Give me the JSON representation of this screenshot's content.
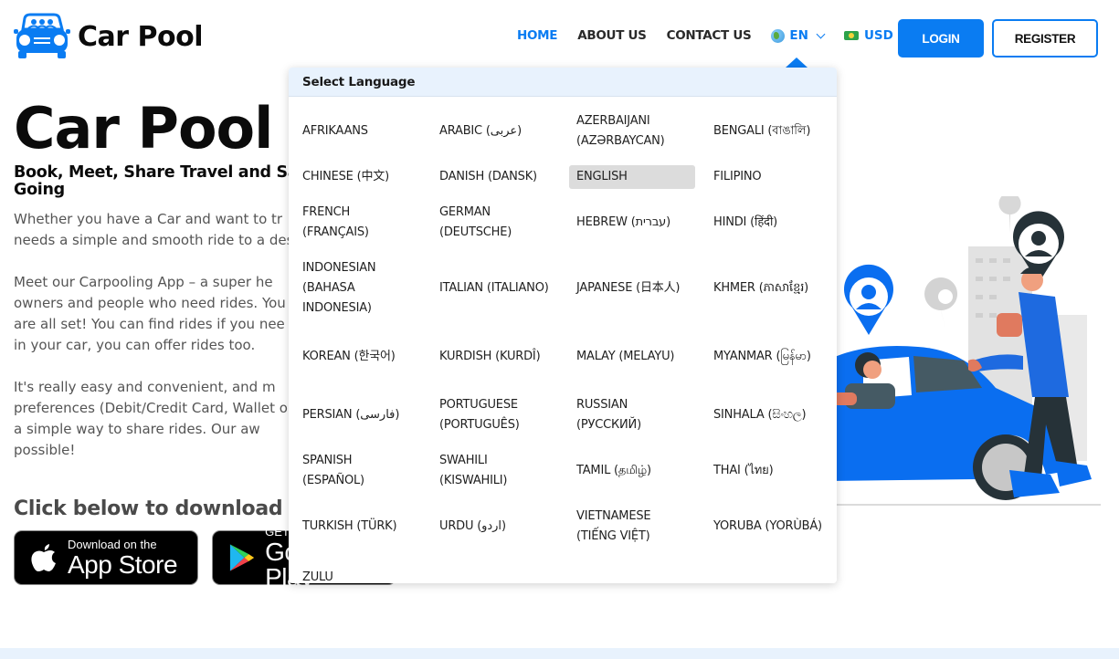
{
  "brand": {
    "name": "Car Pool",
    "accent_color": "#0a7cf2"
  },
  "nav": {
    "items": [
      {
        "label": "HOME",
        "active": true
      },
      {
        "label": "ABOUT US",
        "active": false
      },
      {
        "label": "CONTACT US",
        "active": false
      }
    ],
    "language": {
      "icon": "globe-icon",
      "label": "EN"
    },
    "currency": {
      "icon": "money-icon",
      "label": "USD"
    },
    "login_label": "LOGIN",
    "register_label": "REGISTER"
  },
  "hero": {
    "title": "Car Pool",
    "subtitle": "Book, Meet, Share Travel and Save Going",
    "subtitle_visible_line1": "Book, Meet, Share Travel and Sav",
    "subtitle_visible_line2": "Going",
    "paragraph1": "Whether you have a Car and want to tr… needs a simple and smooth ride to a des…",
    "paragraph1_lines": [
      "Whether you have a Car and want to tr",
      "needs a simple and smooth ride to a des"
    ],
    "paragraph2_lines": [
      "Meet our Carpooling App – a super he",
      "owners and people who need rides. You",
      "are all set! You can find rides if you nee",
      "in your car, you can offer rides too."
    ],
    "paragraph3_lines": [
      "It's really easy and convenient, and m",
      "preferences (Debit/Credit Card, Wallet o",
      "a simple way to share rides. Our aw",
      "possible!"
    ],
    "download_title": "Click below to download the",
    "app_store": {
      "small": "Download on the",
      "big": "App Store"
    },
    "google_play": {
      "small": "GET IT ON",
      "big": "Google Play"
    }
  },
  "language_dropdown": {
    "header": "Select Language",
    "selected": "ENGLISH",
    "options": [
      "AFRIKAANS",
      "ARABIC (عربى)",
      "AZERBAIJANI (AZƏRBAYCAN)",
      "BENGALI (বাঙালি)",
      "CHINESE (中文)",
      "DANISH (DANSK)",
      "ENGLISH",
      "FILIPINO",
      "FRENCH (FRANÇAIS)",
      "GERMAN (DEUTSCHE)",
      "HEBREW (עברית)",
      "HINDI (हिंदी)",
      "INDONESIAN (BAHASA INDONESIA)",
      "ITALIAN (ITALIANO)",
      "JAPANESE (日本人)",
      "KHMER (ភាសាខ្មែរ)",
      "KOREAN (한국어)",
      "KURDISH (KURDÎ)",
      "MALAY (MELAYU)",
      "MYANMAR (မြန်မာ)",
      "PERSIAN (فارسی)",
      "PORTUGUESE (PORTUGUÊS)",
      "RUSSIAN (РУССКИЙ)",
      "SINHALA (සිංහල)",
      "SPANISH (ESPAÑOL)",
      "SWAHILI (KISWAHILI)",
      "TAMIL (தமிழ்)",
      "THAI (ไทย)",
      "TURKISH (TÜRK)",
      "URDU (اردو)",
      "VIETNAMESE (TIẾNG VIỆT)",
      "YORUBA (YORÙBÁ)",
      "ZULU"
    ]
  }
}
